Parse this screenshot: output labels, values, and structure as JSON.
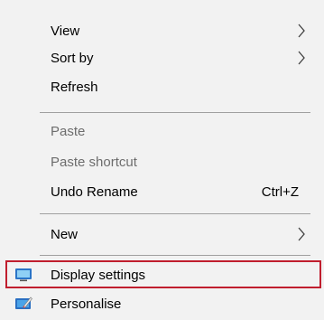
{
  "menu": {
    "items": [
      {
        "label": "View",
        "shortcut": "",
        "submenu": true,
        "disabled": false
      },
      {
        "label": "Sort by",
        "shortcut": "",
        "submenu": true,
        "disabled": false
      },
      {
        "label": "Refresh",
        "shortcut": "",
        "submenu": false,
        "disabled": false
      },
      {
        "label": "Paste",
        "shortcut": "",
        "submenu": false,
        "disabled": true
      },
      {
        "label": "Paste shortcut",
        "shortcut": "",
        "submenu": false,
        "disabled": true
      },
      {
        "label": "Undo Rename",
        "shortcut": "Ctrl+Z",
        "submenu": false,
        "disabled": false
      },
      {
        "label": "New",
        "shortcut": "",
        "submenu": true,
        "disabled": false
      },
      {
        "label": "Display settings",
        "shortcut": "",
        "submenu": false,
        "disabled": false,
        "icon": "display-settings-icon"
      },
      {
        "label": "Personalise",
        "shortcut": "",
        "submenu": false,
        "disabled": false,
        "icon": "personalise-icon"
      }
    ]
  },
  "colors": {
    "menu_background": "#f2f2f2",
    "separator": "#a0a0a0",
    "disabled_text": "#6d6d6d",
    "highlight_border": "#c01e2e"
  }
}
